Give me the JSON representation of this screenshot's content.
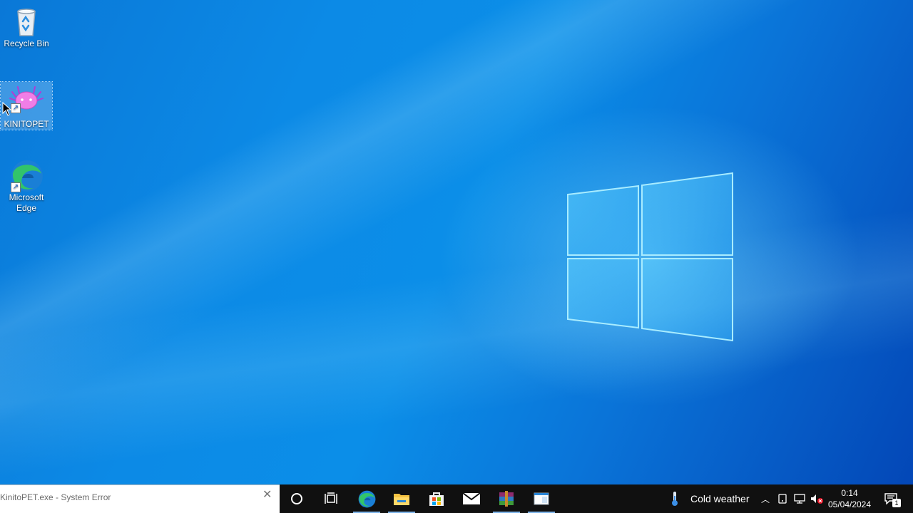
{
  "desktop": {
    "icons": [
      {
        "label": "Recycle Bin",
        "icon": "recycle-bin-icon"
      },
      {
        "label": "KINITOPET",
        "icon": "axolotl-icon"
      },
      {
        "label": "Microsoft Edge",
        "icon": "edge-icon"
      }
    ]
  },
  "taskbar": {
    "search_text": "KinitoPET.exe - System Error",
    "weather_label": "Cold weather",
    "time": "0:14",
    "date": "05/04/2024",
    "notification_count": "1",
    "pinned": [
      "cortana-icon",
      "task-view-icon",
      "edge-icon",
      "file-explorer-icon",
      "store-icon",
      "mail-icon",
      "winrar-icon",
      "window-icon"
    ]
  },
  "colors": {
    "accent": "#0a78d7",
    "taskbar": "#101010"
  }
}
